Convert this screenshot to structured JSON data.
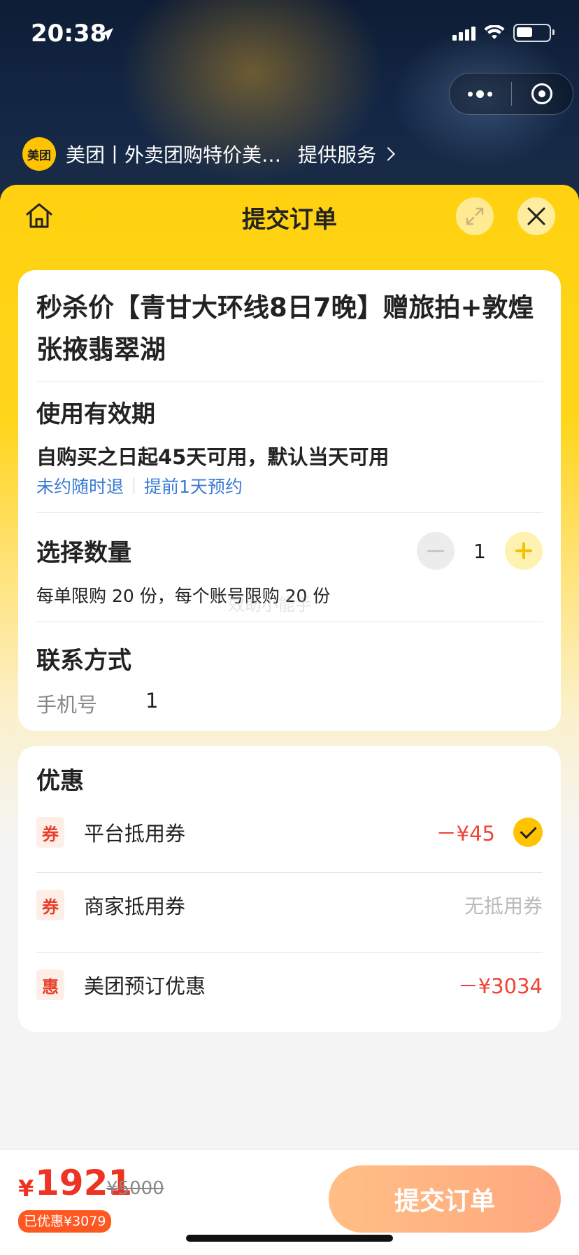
{
  "status": {
    "time": "20:38"
  },
  "provider": {
    "logo_text": "美团",
    "name": "美团丨外卖团购特价美…",
    "service_label": "提供服务"
  },
  "header": {
    "title": "提交订单"
  },
  "product": {
    "title": "秒杀价【青甘大环线8日7晚】赠旅拍+敦煌张掖翡翠湖"
  },
  "validity": {
    "title": "使用有效期",
    "text": "自购买之日起45天可用，默认当天可用",
    "tags": [
      "未约随时退",
      "提前1天预约"
    ]
  },
  "quantity": {
    "title": "选择数量",
    "value": "1",
    "limit": "每单限购 20 份，每个账号限购 20 份"
  },
  "watermark": "效助小能手",
  "contact": {
    "title": "联系方式",
    "phone_label": "手机号",
    "phone_value": "1"
  },
  "discounts": {
    "title": "优惠",
    "items": [
      {
        "badge": "券",
        "label": "平台抵用券",
        "amount": "－¥45",
        "checked": true
      },
      {
        "badge": "券",
        "label": "商家抵用券",
        "amount": "无抵用券"
      },
      {
        "badge": "惠",
        "label": "美团预订优惠",
        "amount": "－¥3034"
      }
    ]
  },
  "footer": {
    "currency": "¥",
    "price": "1921",
    "original_price": "¥5000",
    "saved": "已优惠¥3079",
    "submit_label": "提交订单"
  }
}
